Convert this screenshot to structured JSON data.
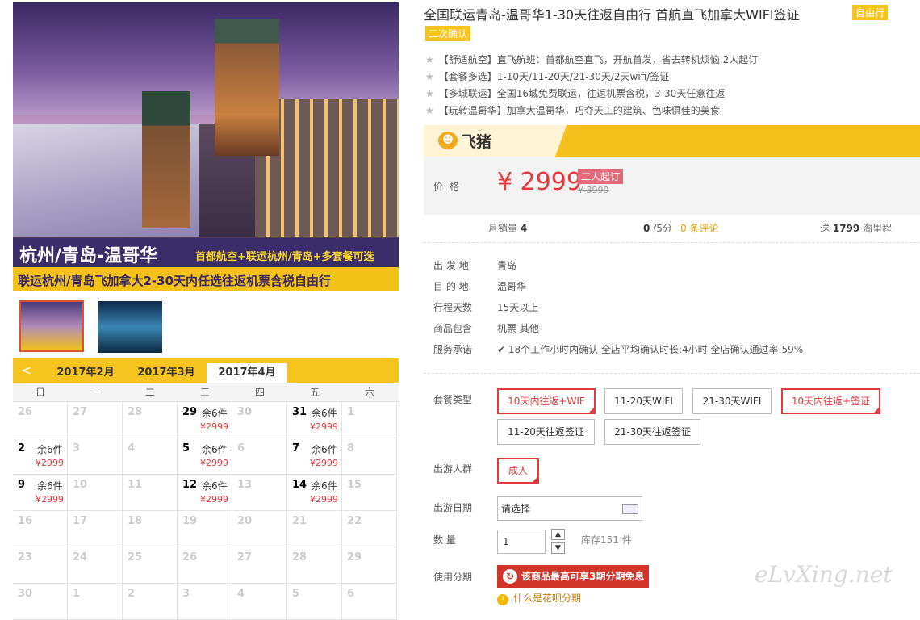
{
  "hero": {
    "banner_title": "杭州/青岛-温哥华",
    "banner_sub": "首都航空+联运杭州/青岛+多套餐可选",
    "banner_bottom": "联运杭州/青岛飞加拿大2-30天内任选往返机票含税自由行"
  },
  "calendar": {
    "prev_icon": "chevron-left-icon",
    "months": [
      "2017年2月",
      "2017年3月",
      "2017年4月"
    ],
    "active_month": "2017年4月",
    "weekdays": [
      "日",
      "一",
      "二",
      "三",
      "四",
      "五",
      "六"
    ],
    "rows": [
      [
        {
          "d": "26"
        },
        {
          "d": "27"
        },
        {
          "d": "28"
        },
        {
          "d": "29",
          "s": "余6件",
          "p": "¥2999"
        },
        {
          "d": "30"
        },
        {
          "d": "31",
          "s": "余6件",
          "p": "¥2999"
        },
        {
          "d": "1"
        }
      ],
      [
        {
          "d": "2",
          "s": "余6件",
          "p": "¥2999"
        },
        {
          "d": "3"
        },
        {
          "d": "4"
        },
        {
          "d": "5",
          "s": "余6件",
          "p": "¥2999"
        },
        {
          "d": "6"
        },
        {
          "d": "7",
          "s": "余6件",
          "p": "¥2999"
        },
        {
          "d": "8"
        }
      ],
      [
        {
          "d": "9",
          "s": "余6件",
          "p": "¥2999"
        },
        {
          "d": "10"
        },
        {
          "d": "11"
        },
        {
          "d": "12",
          "s": "余6件",
          "p": "¥2999"
        },
        {
          "d": "13"
        },
        {
          "d": "14",
          "s": "余6件",
          "p": "¥2999"
        },
        {
          "d": "15"
        }
      ],
      [
        {
          "d": "16"
        },
        {
          "d": "17"
        },
        {
          "d": "18"
        },
        {
          "d": "19"
        },
        {
          "d": "20"
        },
        {
          "d": "21"
        },
        {
          "d": "22"
        }
      ],
      [
        {
          "d": "23"
        },
        {
          "d": "24"
        },
        {
          "d": "25"
        },
        {
          "d": "26"
        },
        {
          "d": "27"
        },
        {
          "d": "28"
        },
        {
          "d": "29"
        }
      ],
      [
        {
          "d": "30"
        },
        {
          "d": "1"
        },
        {
          "d": "2"
        },
        {
          "d": "3"
        },
        {
          "d": "4"
        },
        {
          "d": "5"
        },
        {
          "d": "6"
        }
      ]
    ]
  },
  "product": {
    "title": "全国联运青岛-温哥华1-30天往返自由行 首航直飞加拿大WIFI签证",
    "tag_free": "自由行",
    "tag_confirm": "二次确认",
    "features": [
      "【舒适航空】直飞航班：首都航空直飞，开航首发，省去转机烦恼,2人起订",
      "【套餐多选】1-10天/11-20天/21-30天/2天wifi/签证",
      "【多城联运】全国16城免费联运，往返机票含税，3-30天任意往返",
      "【玩转温哥华】加拿大温哥华，巧夺天工的建筑、色味俱佳的美食"
    ]
  },
  "brand": {
    "name": "飞猪",
    "logo_icon": "fliggy-logo-icon"
  },
  "price": {
    "label": "价格",
    "current": "¥ 2999",
    "min_badge": "二人起订",
    "original": "¥ 3999"
  },
  "stats": {
    "sales_label": "月销量",
    "sales": "4",
    "rating": "0",
    "rating_suffix": "/5分",
    "reviews": "0 条评论",
    "miles_prefix": "送",
    "miles": "1799",
    "miles_suffix": "淘里程"
  },
  "info": [
    {
      "label": "出 发 地",
      "value": "青岛"
    },
    {
      "label": "目 的 地",
      "value": "温哥华"
    },
    {
      "label": "行程天数",
      "value": "15天以上"
    },
    {
      "label": "商品包含",
      "value": "机票  其他"
    },
    {
      "label": "服务承诺",
      "value": "18个工作小时内确认    全店平均确认时长:4小时    全店确认通过率:59%"
    }
  ],
  "options": {
    "package_label": "套餐类型",
    "packages": [
      "10天内往返+WIF",
      "11-20天WIFI",
      "21-30天WIFI",
      "10天内往返+签证",
      "11-20天往返签证",
      "21-30天往返签证"
    ],
    "people_label": "出游人群",
    "people": "成人",
    "date_label": "出游日期",
    "date_value": "请选择",
    "qty_label": "数   量",
    "qty_value": "1",
    "stock": "库存151 件",
    "installment_label": "使用分期",
    "installment_button": "该商品最高可享3期分期免息",
    "installment_help": "什么是花呗分期"
  },
  "watermark": "eLvXing.net"
}
